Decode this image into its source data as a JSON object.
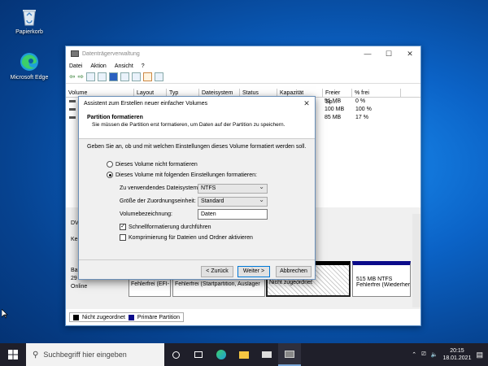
{
  "desktop": {
    "icons": [
      {
        "label": "Papierkorb"
      },
      {
        "label": "Microsoft Edge"
      }
    ]
  },
  "diskmgmt": {
    "title": "Datenträgerverwaltung",
    "menu": [
      "Datei",
      "Aktion",
      "Ansicht",
      "?"
    ],
    "columns": [
      "Volume",
      "Layout",
      "Typ",
      "Dateisystem",
      "Status",
      "Kapazität",
      "Freier Sp...",
      "% frei"
    ],
    "rows": [
      {
        "free": "51 MB",
        "pct": "0 %"
      },
      {
        "free": "100 MB",
        "pct": "100 %"
      },
      {
        "free": "85 MB",
        "pct": "17 %"
      }
    ],
    "disk_labels": {
      "dv": "DV",
      "ke": "Ke",
      "ba": "Ba",
      "n29": "29",
      "online": "Online"
    },
    "partitions": [
      {
        "label": "Fehlerfrei (EFI-"
      },
      {
        "label": "Fehlerfrei (Startpartition, Auslager"
      },
      {
        "label": "Nicht zugeordnet"
      },
      {
        "size": "515 MB NTFS",
        "label": "Fehlerfrei (Wiederher"
      }
    ],
    "legend": {
      "unallocated": "Nicht zugeordnet",
      "primary": "Primäre Partition"
    }
  },
  "wizard": {
    "title": "Assistent zum Erstellen neuer einfacher Volumes",
    "heading": "Partition formatieren",
    "subheading": "Sie müssen die Partition erst formatieren, um Daten auf der Partition zu speichern.",
    "intro": "Geben Sie an, ob und mit welchen Einstellungen dieses Volume formatiert werden soll.",
    "radio_no_format": "Dieses Volume nicht formatieren",
    "radio_format": "Dieses Volume mit folgenden Einstellungen formatieren:",
    "fs_label": "Zu verwendendes Dateisystem:",
    "fs_value": "NTFS",
    "alloc_label": "Größe der Zuordnungseinheit:",
    "alloc_value": "Standard",
    "vol_label": "Volumebezeichnung:",
    "vol_value": "Daten",
    "quick_format": "Schnellformatierung durchführen",
    "compression": "Komprimierung für Dateien und Ordner aktivieren",
    "back": "< Zurück",
    "next": "Weiter >",
    "cancel": "Abbrechen"
  },
  "taskbar": {
    "search_placeholder": "Suchbegriff hier eingeben",
    "time": "20:15",
    "date": "18.01.2021"
  },
  "colors": {
    "accent": "#0078d7",
    "primary_partition": "#0b0b8a",
    "unallocated": "#000000"
  }
}
